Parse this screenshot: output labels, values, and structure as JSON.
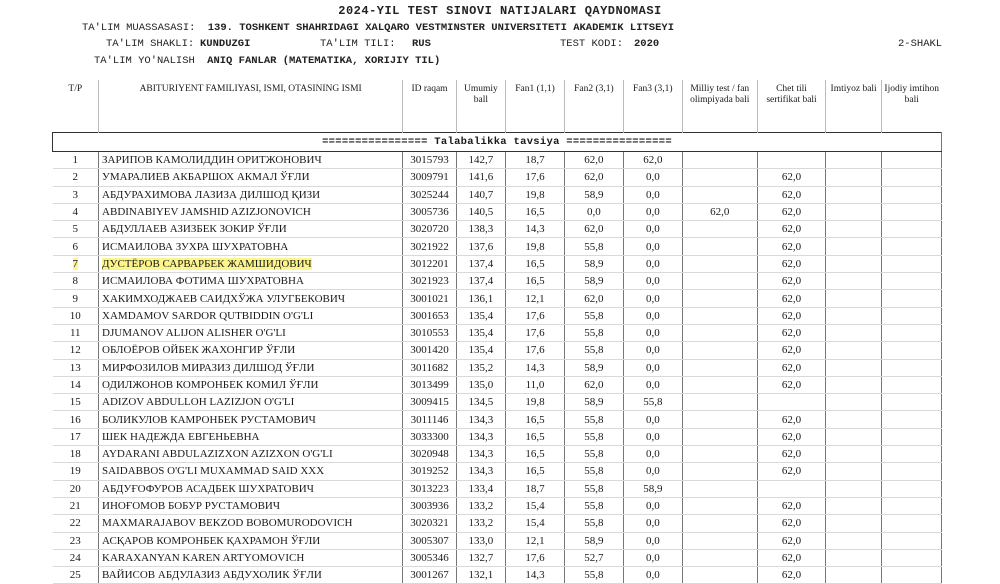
{
  "header": {
    "title": "2024-YIL TEST SINOVI NATIJALARI QAYDNOMASI",
    "institution_label": "TA'LIM MUASSASASI:",
    "institution_value": "139. TOSHKENT SHAHRIDAGI XALQARO VESTMINSTER UNIVERSITETI AKADEMIK LITSEYI",
    "form_label": "TA'LIM SHAKLI:",
    "form_value": "KUNDUZGI",
    "language_label": "TA'LIM TILI:",
    "language_value": "RUS",
    "test_code_label": "TEST KODI:",
    "test_code_value": "2020",
    "variant": "2-SHAKL",
    "direction_label": "TA'LIM YO'NALISH",
    "direction_value": "ANIQ FANLAR (MATEMATIKA, XORIJIY TIL)"
  },
  "columns": [
    "T/P",
    "ABITURIYENT FAMILIYASI, ISMI, OTASINING ISMI",
    "ID raqam",
    "Umumiy ball",
    "Fan1 (1,1)",
    "Fan2 (3,1)",
    "Fan3 (3,1)",
    "Milliy test / fan olimpiyada bali",
    "Chet tili sertifikat bali",
    "Imtiyoz bali",
    "Ijodiy imtihon bali"
  ],
  "section_title": "================ Talabalikka tavsiya ================",
  "highlight_color": "#fbf58a",
  "rows": [
    {
      "n": "1",
      "name": "ЗАРИПОВ КАМОЛИДДИН ОРИТЖОНОВИЧ",
      "id": "3015793",
      "total": "142,7",
      "f1": "18,7",
      "f2": "62,0",
      "f3": "62,0",
      "milliy": "",
      "chet": ""
    },
    {
      "n": "2",
      "name": "УМАРАЛИЕВ АКБАРШОХ АКМАЛ ЎҒЛИ",
      "id": "3009791",
      "total": "141,6",
      "f1": "17,6",
      "f2": "62,0",
      "f3": "0,0",
      "milliy": "",
      "chet": "62,0"
    },
    {
      "n": "3",
      "name": "АБДУРАХИМОВА ЛАЗИЗА ДИЛШОД ҚИЗИ",
      "id": "3025244",
      "total": "140,7",
      "f1": "19,8",
      "f2": "58,9",
      "f3": "0,0",
      "milliy": "",
      "chet": "62,0"
    },
    {
      "n": "4",
      "name": "ABDINABIYEV JAMSHID AZIZJONOVICH",
      "id": "3005736",
      "total": "140,5",
      "f1": "16,5",
      "f2": "0,0",
      "f3": "0,0",
      "milliy": "62,0",
      "chet": "62,0"
    },
    {
      "n": "5",
      "name": "АБДУЛЛАЕВ АЗИЗБЕК ЗОКИР ЎҒЛИ",
      "id": "3020720",
      "total": "138,3",
      "f1": "14,3",
      "f2": "62,0",
      "f3": "0,0",
      "milliy": "",
      "chet": "62,0"
    },
    {
      "n": "6",
      "name": "ИСМАИЛОВА ЗУХРА ШУХРАТОВНА",
      "id": "3021922",
      "total": "137,6",
      "f1": "19,8",
      "f2": "55,8",
      "f3": "0,0",
      "milliy": "",
      "chet": "62,0"
    },
    {
      "n": "7",
      "name": "ДУСТЁРОВ САРВАРБЕК ЖАМШИДОВИЧ",
      "id": "3012201",
      "total": "137,4",
      "f1": "16,5",
      "f2": "58,9",
      "f3": "0,0",
      "milliy": "",
      "chet": "62,0",
      "highlight": true
    },
    {
      "n": "8",
      "name": "ИСМАИЛОВА ФОТИМА ШУХРАТОВНА",
      "id": "3021923",
      "total": "137,4",
      "f1": "16,5",
      "f2": "58,9",
      "f3": "0,0",
      "milliy": "",
      "chet": "62,0"
    },
    {
      "n": "9",
      "name": "ХАКИМХОДЖАЕВ САИДХЎЖА УЛУГБЕКОВИЧ",
      "id": "3001021",
      "total": "136,1",
      "f1": "12,1",
      "f2": "62,0",
      "f3": "0,0",
      "milliy": "",
      "chet": "62,0"
    },
    {
      "n": "10",
      "name": "XAMDAMOV SARDOR QUTBIDDIN O'G'LI",
      "id": "3001653",
      "total": "135,4",
      "f1": "17,6",
      "f2": "55,8",
      "f3": "0,0",
      "milliy": "",
      "chet": "62,0"
    },
    {
      "n": "11",
      "name": "DJUMANOV ALIJON ALISHER O'G'LI",
      "id": "3010553",
      "total": "135,4",
      "f1": "17,6",
      "f2": "55,8",
      "f3": "0,0",
      "milliy": "",
      "chet": "62,0"
    },
    {
      "n": "12",
      "name": "ОБЛОЁРОВ ОЙБЕК ЖАХОНГИР ЎҒЛИ",
      "id": "3001420",
      "total": "135,4",
      "f1": "17,6",
      "f2": "55,8",
      "f3": "0,0",
      "milliy": "",
      "chet": "62,0"
    },
    {
      "n": "13",
      "name": "МИРФОЗИЛОВ МИРАЗИЗ ДИЛШОД ЎҒЛИ",
      "id": "3011682",
      "total": "135,2",
      "f1": "14,3",
      "f2": "58,9",
      "f3": "0,0",
      "milliy": "",
      "chet": "62,0"
    },
    {
      "n": "14",
      "name": "ОДИЛЖОНОВ КОМРОНБЕК КОМИЛ ЎҒЛИ",
      "id": "3013499",
      "total": "135,0",
      "f1": "11,0",
      "f2": "62,0",
      "f3": "0,0",
      "milliy": "",
      "chet": "62,0"
    },
    {
      "n": "15",
      "name": "ADIZOV ABDULLOH LAZIZJON O'G'LI",
      "id": "3009415",
      "total": "134,5",
      "f1": "19,8",
      "f2": "58,9",
      "f3": "55,8",
      "milliy": "",
      "chet": ""
    },
    {
      "n": "16",
      "name": "БОЛИКУЛОВ КАМРОНБЕК РУСТАМОВИЧ",
      "id": "3011146",
      "total": "134,3",
      "f1": "16,5",
      "f2": "55,8",
      "f3": "0,0",
      "milliy": "",
      "chet": "62,0"
    },
    {
      "n": "17",
      "name": "ШЕК НАДЕЖДА ЕВГЕНЬЕВНА",
      "id": "3033300",
      "total": "134,3",
      "f1": "16,5",
      "f2": "55,8",
      "f3": "0,0",
      "milliy": "",
      "chet": "62,0"
    },
    {
      "n": "18",
      "name": "AYDARANI ABDULAZIZXON AZIZXON O'G'LI",
      "id": "3020948",
      "total": "134,3",
      "f1": "16,5",
      "f2": "55,8",
      "f3": "0,0",
      "milliy": "",
      "chet": "62,0"
    },
    {
      "n": "19",
      "name": "SAIDABBOS O'G'LI MUXAMMAD SAID XXX",
      "id": "3019252",
      "total": "134,3",
      "f1": "16,5",
      "f2": "55,8",
      "f3": "0,0",
      "milliy": "",
      "chet": "62,0"
    },
    {
      "n": "20",
      "name": "АБДУҒОФУРОВ АСАДБЕК ШУХРАТОВИЧ",
      "id": "3013223",
      "total": "133,4",
      "f1": "18,7",
      "f2": "55,8",
      "f3": "58,9",
      "milliy": "",
      "chet": ""
    },
    {
      "n": "21",
      "name": "ИНОҒОМОВ БОБУР РУСТАМОВИЧ",
      "id": "3003936",
      "total": "133,2",
      "f1": "15,4",
      "f2": "55,8",
      "f3": "0,0",
      "milliy": "",
      "chet": "62,0"
    },
    {
      "n": "22",
      "name": "MAXMARAJABOV BEKZOD BOBOMURODOVICH",
      "id": "3020321",
      "total": "133,2",
      "f1": "15,4",
      "f2": "55,8",
      "f3": "0,0",
      "milliy": "",
      "chet": "62,0"
    },
    {
      "n": "23",
      "name": "АСҚАРОВ КОМРОНБЕК ҚАХРАМОН ЎҒЛИ",
      "id": "3005307",
      "total": "133,0",
      "f1": "12,1",
      "f2": "58,9",
      "f3": "0,0",
      "milliy": "",
      "chet": "62,0"
    },
    {
      "n": "24",
      "name": "KARAXANYAN KAREN ARTYOMOVICH",
      "id": "3005346",
      "total": "132,7",
      "f1": "17,6",
      "f2": "52,7",
      "f3": "0,0",
      "milliy": "",
      "chet": "62,0"
    },
    {
      "n": "25",
      "name": "ВАЙИСОВ АБДУЛАЗИЗ АБДУХОЛИК ЎҒЛИ",
      "id": "3001267",
      "total": "132,1",
      "f1": "14,3",
      "f2": "55,8",
      "f3": "0,0",
      "milliy": "",
      "chet": "62,0"
    }
  ]
}
